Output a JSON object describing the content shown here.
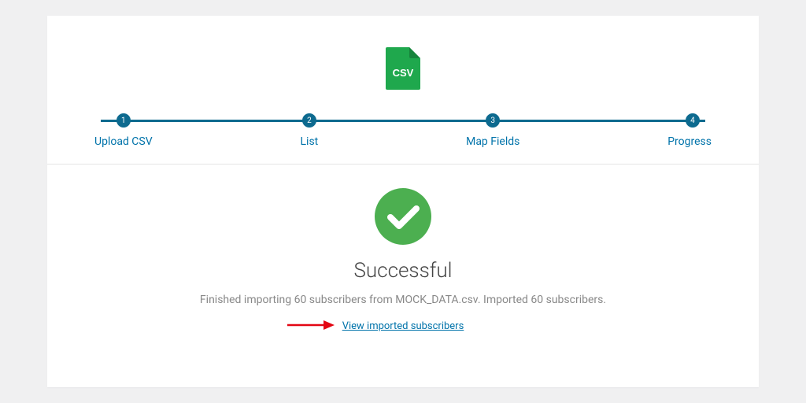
{
  "csv_icon_label": "CSV",
  "stepper": {
    "steps": [
      {
        "num": "1",
        "label": "Upload CSV"
      },
      {
        "num": "2",
        "label": "List"
      },
      {
        "num": "3",
        "label": "Map Fields"
      },
      {
        "num": "4",
        "label": "Progress"
      }
    ]
  },
  "result": {
    "title": "Successful",
    "message": "Finished importing 60 subscribers from MOCK_DATA.csv. Imported 60 subscribers.",
    "link_label": "View imported subscribers"
  },
  "colors": {
    "stepper": "#0d6a8f",
    "link": "#0073aa",
    "success": "#4caf50",
    "csv": "#1fa84d",
    "arrow": "#e30613"
  }
}
